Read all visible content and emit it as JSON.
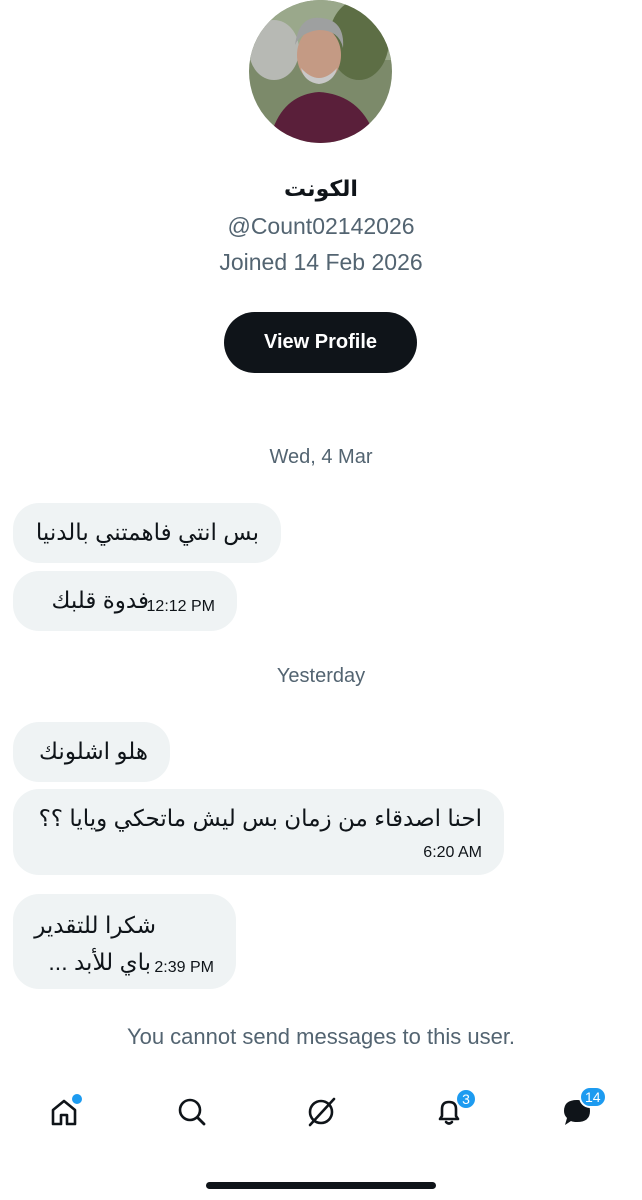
{
  "profile": {
    "name": "الكونت",
    "handle": "@Count02142026",
    "joined": "Joined 14 Feb 2026",
    "view_profile_label": "View Profile"
  },
  "conversation": {
    "days": [
      {
        "label": "Wed, 4 Mar",
        "messages": [
          {
            "text": "بس انتي فاهمتني بالدنيا",
            "time": ""
          },
          {
            "text": "فدوة قلبك",
            "time": "12:12 PM"
          }
        ]
      },
      {
        "label": "Yesterday",
        "messages": [
          {
            "text": "هلو اشلونك",
            "time": ""
          },
          {
            "text": "احنا اصدقاء من زمان بس ليش ماتحكي ويايا ؟؟",
            "time": "6:20 AM"
          },
          {
            "text_line1": "شكرا للتقدير",
            "text_line2": "باي للأبد ...",
            "time": "2:39 PM"
          }
        ]
      }
    ],
    "notice": "You cannot send messages to this user."
  },
  "tabbar": {
    "items": [
      {
        "icon": "home-icon",
        "has_dot": true
      },
      {
        "icon": "search-icon"
      },
      {
        "icon": "grok-icon"
      },
      {
        "icon": "bell-icon",
        "badge": "3"
      },
      {
        "icon": "messages-icon",
        "badge": "14"
      }
    ]
  },
  "colors": {
    "accent": "#1d9bf0",
    "bubble": "#eff3f4",
    "secondary_text": "#536471",
    "primary_text": "#0f1419"
  }
}
